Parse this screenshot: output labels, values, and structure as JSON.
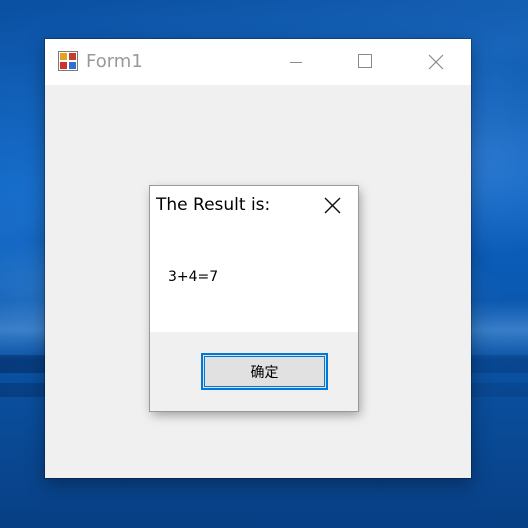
{
  "desktop": {
    "background_color": "#0b56a8"
  },
  "main_window": {
    "title": "Form1",
    "icon": "winforms-app-icon",
    "controls": {
      "minimize": "minimize-icon",
      "maximize": "maximize-icon",
      "close": "close-icon"
    }
  },
  "dialog": {
    "title": "The Result is:",
    "message": "3+4=7",
    "ok_label": "确定",
    "close": "close-icon",
    "accent_color": "#0078d7"
  }
}
